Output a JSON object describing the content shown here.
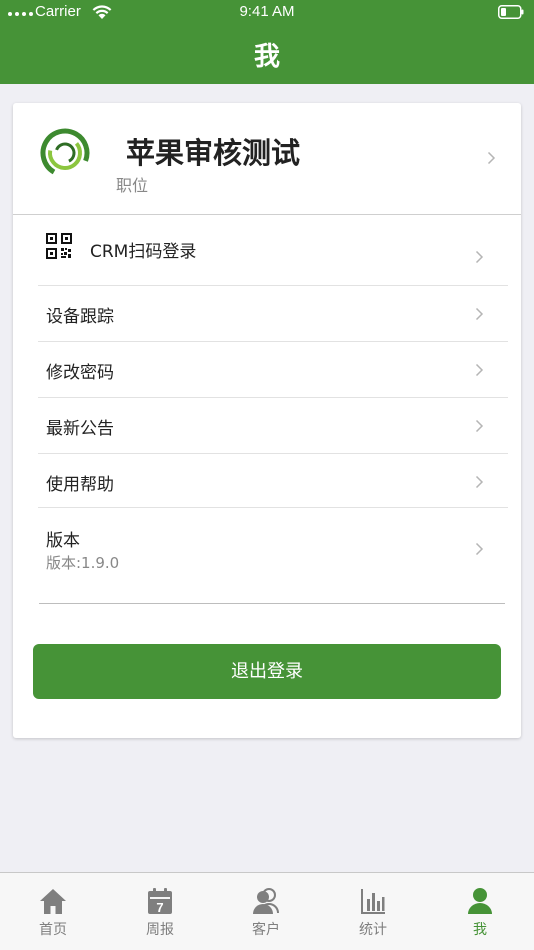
{
  "status_bar": {
    "carrier": "Carrier",
    "time": "9:41 AM"
  },
  "nav": {
    "title": "我"
  },
  "profile": {
    "name": "苹果审核测试",
    "role": "职位"
  },
  "menu": {
    "items": [
      {
        "label": "CRM扫码登录",
        "icon": "qr-code-icon"
      },
      {
        "label": "设备跟踪"
      },
      {
        "label": "修改密码"
      },
      {
        "label": "最新公告"
      },
      {
        "label": "使用帮助"
      },
      {
        "label": "版本",
        "sub": "版本:1.9.0"
      }
    ]
  },
  "logout": {
    "label": "退出登录"
  },
  "tabbar": {
    "tabs": [
      {
        "label": "首页",
        "icon": "home-icon"
      },
      {
        "label": "周报",
        "icon": "calendar-icon",
        "icon_text": "7"
      },
      {
        "label": "客户",
        "icon": "customers-icon"
      },
      {
        "label": "统计",
        "icon": "bar-chart-icon"
      },
      {
        "label": "我",
        "icon": "person-icon",
        "active": true
      }
    ]
  },
  "colors": {
    "primary": "#469337",
    "background": "#efeff4",
    "tab_inactive": "#7f7f7f"
  }
}
